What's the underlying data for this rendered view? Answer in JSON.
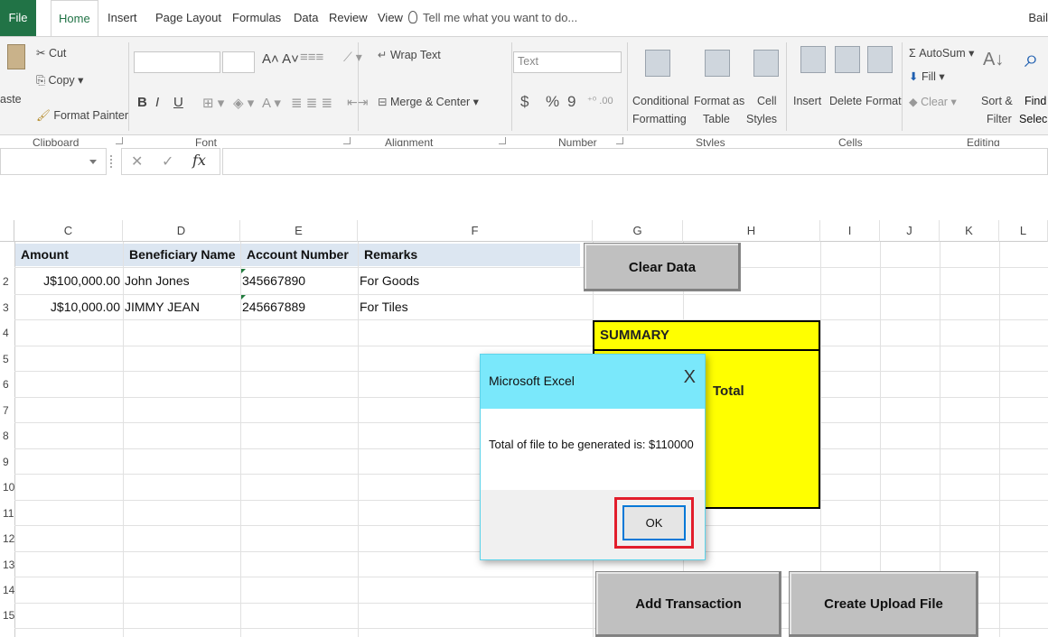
{
  "ribbon_tabs": {
    "file": "File",
    "home": "Home",
    "insert": "Insert",
    "page_layout": "Page Layout",
    "formulas": "Formulas",
    "data": "Data",
    "review": "Review",
    "view": "View",
    "tell_me": "Tell me what you want to do...",
    "user": "Bail"
  },
  "ribbon": {
    "clipboard": {
      "paste": "aste",
      "cut": "Cut",
      "copy": "Copy",
      "format_painter": "Format Painter",
      "label": "Clipboard"
    },
    "font": {
      "bold": "B",
      "italic": "I",
      "underline": "U",
      "label": "Font"
    },
    "alignment": {
      "wrap_text": "Wrap Text",
      "merge_center": "Merge & Center",
      "label": "Alignment"
    },
    "number": {
      "format_value": "Text",
      "currency": "$",
      "percent": "%",
      "comma": "9",
      "label": "Number"
    },
    "styles": {
      "conditional": "Conditional",
      "formatting": "Formatting",
      "format_as": "Format as",
      "table": "Table",
      "cell": "Cell",
      "cell_styles": "Styles",
      "label": "Styles"
    },
    "cells": {
      "insert": "Insert",
      "delete": "Delete",
      "format": "Format",
      "label": "Cells"
    },
    "editing": {
      "autosum": "AutoSum",
      "fill": "Fill",
      "clear": "Clear",
      "sort": "Sort &",
      "filter": "Filter",
      "find": "Find",
      "select": "Selec",
      "label": "Editing"
    }
  },
  "formula_bar": {
    "cancel": "✕",
    "enter": "✓",
    "fx": "fx",
    "value": ""
  },
  "grid": {
    "columns": [
      "C",
      "D",
      "E",
      "F",
      "G",
      "H",
      "I",
      "J",
      "K",
      "L"
    ],
    "row_numbers": [
      "",
      "2",
      "3",
      "4",
      "5",
      "6",
      "7",
      "8",
      "9",
      "10",
      "11",
      "12",
      "13",
      "14",
      "15"
    ],
    "headers": {
      "amount": "Amount",
      "beneficiary": "Beneficiary Name",
      "account": "Account Number",
      "remarks": "Remarks"
    },
    "rows": [
      {
        "amount": "J$100,000.00",
        "beneficiary": "John Jones",
        "account": "345667890",
        "remarks": "For Goods"
      },
      {
        "amount": "J$10,000.00",
        "beneficiary": "JIMMY JEAN",
        "account": "245667889",
        "remarks": "For Tiles"
      }
    ]
  },
  "sheet_buttons": {
    "clear_data": "Clear Data",
    "add_transaction": "Add Transaction",
    "create_upload": "Create Upload File"
  },
  "summary": {
    "title": "SUMMARY",
    "total": "Total"
  },
  "dialog": {
    "title": "Microsoft Excel",
    "close": "X",
    "message": "Total of file to be generated is: $110000",
    "ok": "OK"
  },
  "colors": {
    "excel_green": "#217346",
    "header_fill": "#dce6f1",
    "summary_fill": "#ffff00",
    "dialog_title": "#7ae8fb",
    "highlight": "#e21e2c"
  }
}
